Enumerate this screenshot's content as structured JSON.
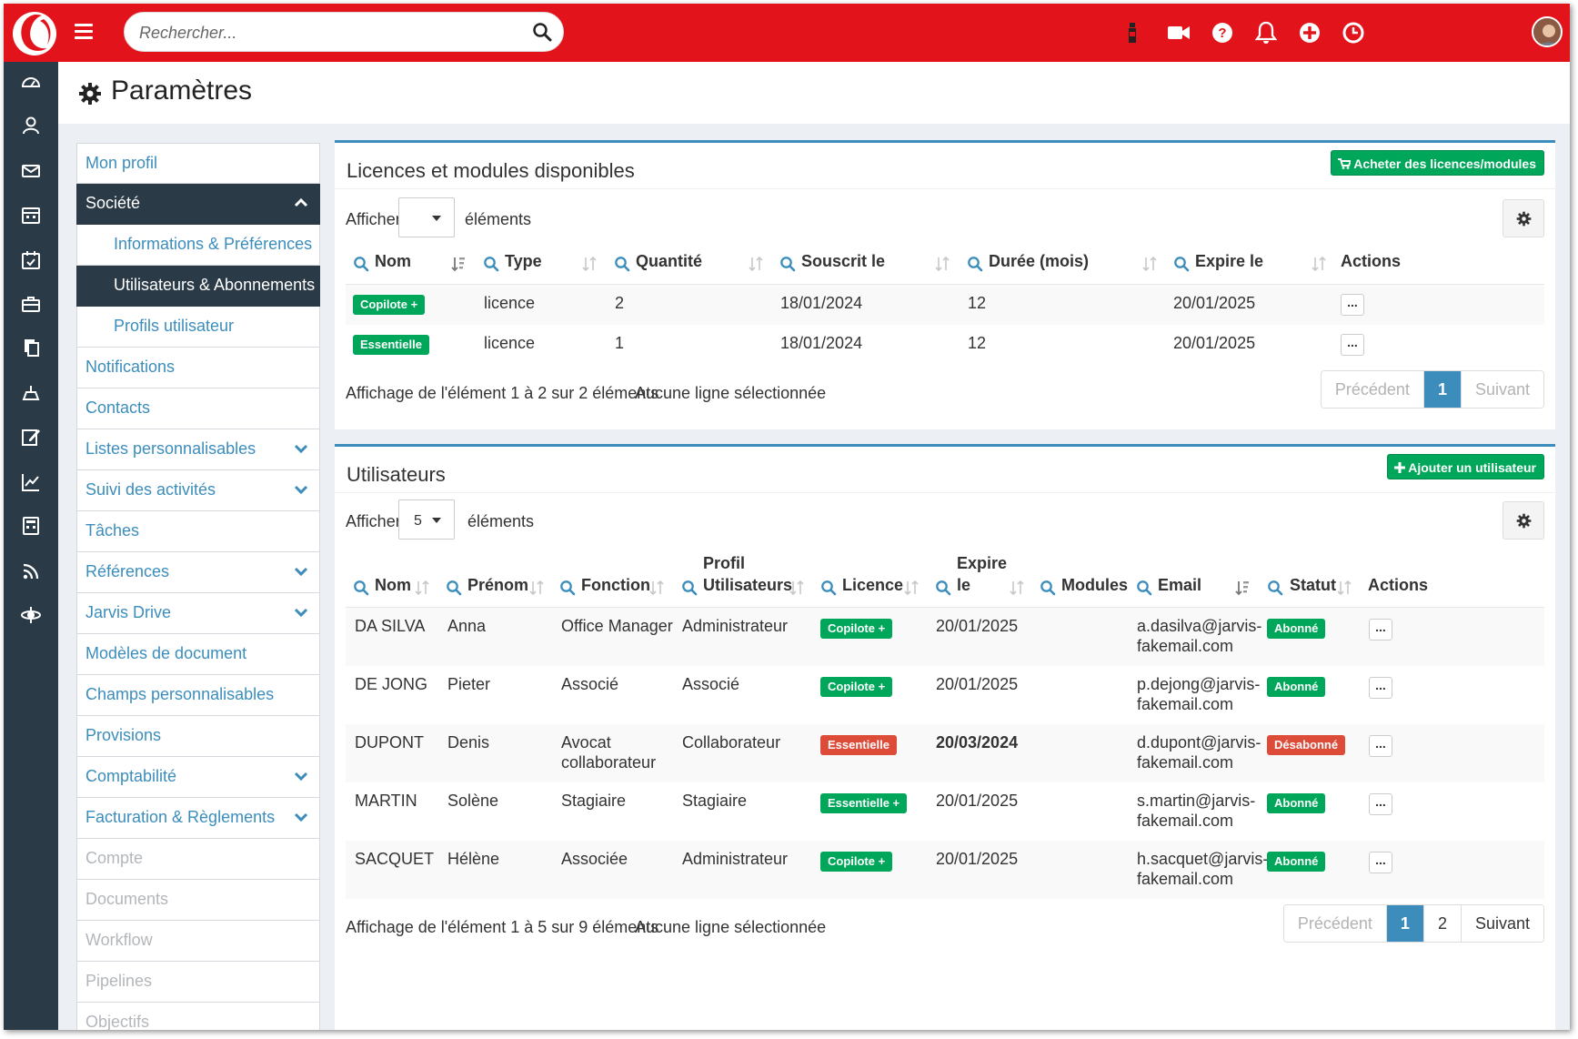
{
  "topbar": {
    "search_placeholder": "Rechercher...",
    "icons": [
      "wine-bottle-icon",
      "video-camera-icon",
      "help-icon",
      "bell-icon",
      "plus-circle-icon",
      "clock-icon",
      "user-avatar"
    ]
  },
  "rail": {
    "icons": [
      "dashboard-icon",
      "contacts-icon",
      "mail-icon",
      "calendar-icon",
      "calendar-check-icon",
      "briefcase-icon",
      "documents-icon",
      "scale-icon",
      "edit-icon",
      "chart-icon",
      "calculator-icon",
      "rss-icon",
      "network-icon"
    ]
  },
  "page": {
    "title": "Paramètres"
  },
  "menu": {
    "items": [
      {
        "label": "Mon profil",
        "state": "normal",
        "chevron": "none",
        "sub": false
      },
      {
        "label": "Société",
        "state": "active",
        "chevron": "up",
        "sub": false
      },
      {
        "label": "Informations & Préférences",
        "state": "normal",
        "chevron": "none",
        "sub": true
      },
      {
        "label": "Utilisateurs & Abonnements",
        "state": "active",
        "chevron": "none",
        "sub": true
      },
      {
        "label": "Profils utilisateur",
        "state": "normal",
        "chevron": "none",
        "sub": true
      },
      {
        "label": "Notifications",
        "state": "normal",
        "chevron": "none",
        "sub": false
      },
      {
        "label": "Contacts",
        "state": "normal",
        "chevron": "none",
        "sub": false
      },
      {
        "label": "Listes personnalisables",
        "state": "normal",
        "chevron": "down",
        "sub": false
      },
      {
        "label": "Suivi des activités",
        "state": "normal",
        "chevron": "down",
        "sub": false
      },
      {
        "label": "Tâches",
        "state": "normal",
        "chevron": "none",
        "sub": false
      },
      {
        "label": "Références",
        "state": "normal",
        "chevron": "down",
        "sub": false
      },
      {
        "label": "Jarvis Drive",
        "state": "normal",
        "chevron": "down",
        "sub": false
      },
      {
        "label": "Modèles de document",
        "state": "normal",
        "chevron": "none",
        "sub": false
      },
      {
        "label": "Champs personnalisables",
        "state": "normal",
        "chevron": "none",
        "sub": false
      },
      {
        "label": "Provisions",
        "state": "normal",
        "chevron": "none",
        "sub": false
      },
      {
        "label": "Comptabilité",
        "state": "normal",
        "chevron": "down",
        "sub": false
      },
      {
        "label": "Facturation & Règlements",
        "state": "normal",
        "chevron": "down",
        "sub": false
      },
      {
        "label": "Compte",
        "state": "disabled",
        "chevron": "none",
        "sub": false
      },
      {
        "label": "Documents",
        "state": "disabled",
        "chevron": "none",
        "sub": false
      },
      {
        "label": "Workflow",
        "state": "disabled",
        "chevron": "none",
        "sub": false
      },
      {
        "label": "Pipelines",
        "state": "disabled",
        "chevron": "none",
        "sub": false
      },
      {
        "label": "Objectifs",
        "state": "disabled",
        "chevron": "none",
        "sub": false
      }
    ]
  },
  "licences": {
    "title": "Licences et modules disponibles",
    "buy_button": "Acheter des licences/modules",
    "show_label": "Afficher",
    "show_value": "",
    "elements_label": "éléments",
    "columns": [
      "Nom",
      "Type",
      "Quantité",
      "Souscrit le",
      "Durée (mois)",
      "Expire le",
      "Actions"
    ],
    "rows": [
      {
        "name": "Copilote +",
        "type": "licence",
        "qty": "2",
        "subscribed": "18/01/2024",
        "duration": "12",
        "expires": "20/01/2025"
      },
      {
        "name": "Essentielle",
        "type": "licence",
        "qty": "1",
        "subscribed": "18/01/2024",
        "duration": "12",
        "expires": "20/01/2025"
      }
    ],
    "info": "Affichage de l'élément 1 à 2 sur 2 éléments",
    "selection": "Aucune ligne sélectionnée",
    "pager": {
      "prev": "Précédent",
      "pages": [
        "1"
      ],
      "current": "1",
      "next": "Suivant"
    }
  },
  "users": {
    "title": "Utilisateurs",
    "add_button": "Ajouter un utilisateur",
    "show_label": "Afficher",
    "show_value": "5",
    "elements_label": "éléments",
    "columns": {
      "nom": "Nom",
      "prenom": "Prénom",
      "fonction": "Fonction",
      "profil_top": "Profil",
      "profil_bottom": "Utilisateurs",
      "licence": "Licence",
      "expire_top": "Expire",
      "expire_bottom": "le",
      "modules": "Modules",
      "email": "Email",
      "statut": "Statut",
      "actions": "Actions"
    },
    "rows": [
      {
        "nom": "DA SILVA",
        "prenom": "Anna",
        "fonction": [
          "Office Manager"
        ],
        "profil": "Administrateur",
        "licence": "Copilote +",
        "licence_color": "#00a65a",
        "expire": "20/01/2025",
        "expire_bold": false,
        "email": [
          "a.dasilva@jarvis-",
          "fakemail.com"
        ],
        "statut": "Abonné",
        "statut_color": "#00a65a"
      },
      {
        "nom": "DE JONG",
        "prenom": "Pieter",
        "fonction": [
          "Associé"
        ],
        "profil": "Associé",
        "licence": "Copilote +",
        "licence_color": "#00a65a",
        "expire": "20/01/2025",
        "expire_bold": false,
        "email": [
          "p.dejong@jarvis-",
          "fakemail.com"
        ],
        "statut": "Abonné",
        "statut_color": "#00a65a"
      },
      {
        "nom": "DUPONT",
        "prenom": "Denis",
        "fonction": [
          "Avocat",
          "collaborateur"
        ],
        "profil": "Collaborateur",
        "licence": "Essentielle",
        "licence_color": "#dd4b39",
        "expire": "20/03/2024",
        "expire_bold": true,
        "email": [
          "d.dupont@jarvis-",
          "fakemail.com"
        ],
        "statut": "Désabonné",
        "statut_color": "#dd4b39"
      },
      {
        "nom": "MARTIN",
        "prenom": "Solène",
        "fonction": [
          "Stagiaire"
        ],
        "profil": "Stagiaire",
        "licence": "Essentielle +",
        "licence_color": "#00a65a",
        "expire": "20/01/2025",
        "expire_bold": false,
        "email": [
          "s.martin@jarvis-",
          "fakemail.com"
        ],
        "statut": "Abonné",
        "statut_color": "#00a65a"
      },
      {
        "nom": "SACQUET",
        "prenom": "Hélène",
        "fonction": [
          "Associée"
        ],
        "profil": "Administrateur",
        "licence": "Copilote +",
        "licence_color": "#00a65a",
        "expire": "20/01/2025",
        "expire_bold": false,
        "email": [
          "h.sacquet@jarvis-",
          "fakemail.com"
        ],
        "statut": "Abonné",
        "statut_color": "#00a65a"
      }
    ],
    "info": "Affichage de l'élément 1 à 5 sur 9 éléments",
    "selection": "Aucune ligne sélectionnée",
    "pager": {
      "prev": "Précédent",
      "pages": [
        "1",
        "2"
      ],
      "current": "1",
      "next": "Suivant"
    }
  },
  "colors": {
    "brand_red": "#e3131b",
    "rail": "#2b3a47",
    "accent_blue": "#3c8dbc",
    "green": "#00a65a",
    "red": "#dd4b39"
  }
}
